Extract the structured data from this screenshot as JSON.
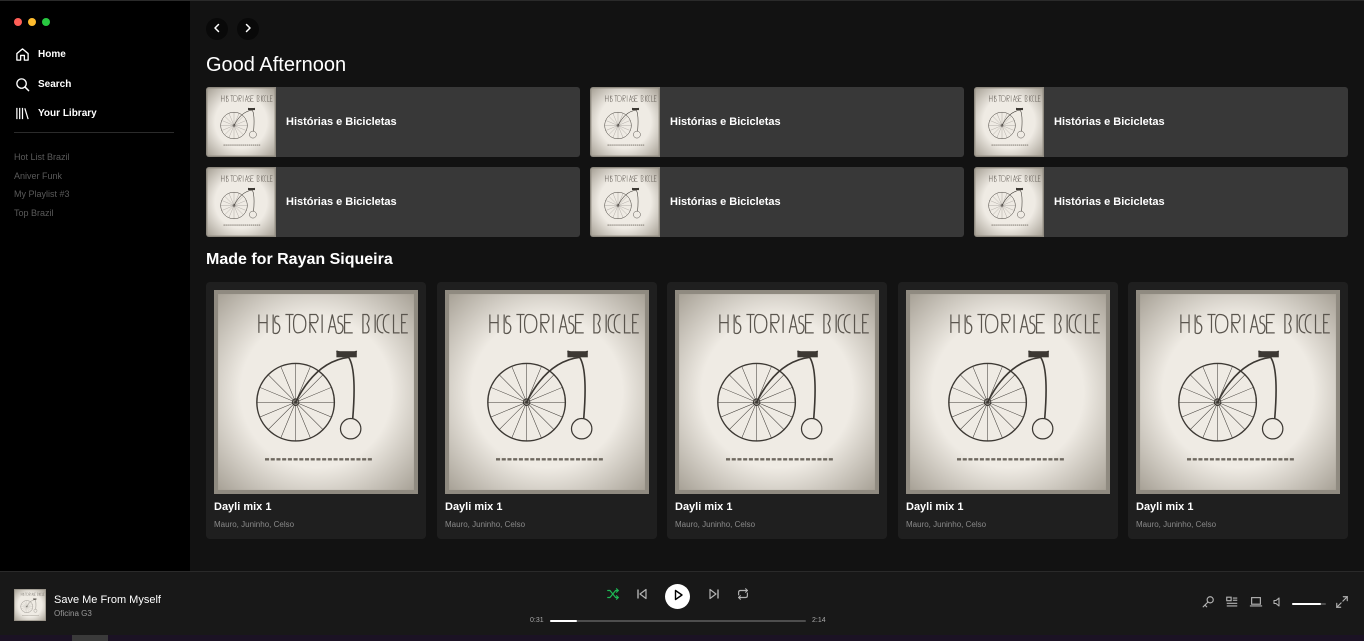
{
  "sidebar": {
    "window_controls": [
      "close",
      "minimize",
      "maximize"
    ],
    "nav": [
      {
        "label": "Home",
        "icon": "home-icon"
      },
      {
        "label": "Search",
        "icon": "search-icon"
      },
      {
        "label": "Your Library",
        "icon": "library-icon"
      }
    ],
    "playlists": [
      "Hot List Brazil",
      "Aniver Funk",
      "My Playlist #3",
      "Top Brazil"
    ]
  },
  "main": {
    "history": {
      "back_icon": "chevron-left-icon",
      "forward_icon": "chevron-right-icon"
    },
    "greeting": "Good Afternoon",
    "shortcuts": [
      {
        "title": "Histórias e Bicicletas"
      },
      {
        "title": "Histórias e Bicicletas"
      },
      {
        "title": "Histórias e Bicicletas"
      },
      {
        "title": "Histórias e Bicicletas"
      },
      {
        "title": "Histórias e Bicicletas"
      },
      {
        "title": "Histórias e Bicicletas"
      }
    ],
    "made_for_title": "Made for Rayan Siqueira",
    "cards": [
      {
        "title": "Dayli mix 1",
        "subtitle": "Mauro, Juninho, Celso"
      },
      {
        "title": "Dayli mix 1",
        "subtitle": "Mauro, Juninho, Celso"
      },
      {
        "title": "Dayli mix 1",
        "subtitle": "Mauro, Juninho, Celso"
      },
      {
        "title": "Dayli mix 1",
        "subtitle": "Mauro, Juninho, Celso"
      },
      {
        "title": "Dayli mix 1",
        "subtitle": "Mauro, Juninho, Celso"
      }
    ]
  },
  "player": {
    "track_title": "Save Me From Myself",
    "track_artist": "Oficina G3",
    "elapsed": "0:31",
    "duration": "2:14",
    "progress_fraction": 0.105,
    "shuffle_active": true,
    "volume_fraction": 0.85,
    "controls": [
      "shuffle-icon",
      "previous-icon",
      "play-icon",
      "next-icon",
      "repeat-icon"
    ],
    "right_controls": [
      "microphone-icon",
      "queue-icon",
      "device-icon",
      "volume-icon",
      "fullscreen-icon"
    ]
  },
  "colors": {
    "accent": "#1db954",
    "background": "#121212",
    "sidebar": "#000000",
    "card": "#1f1f1f",
    "shortcut": "#383838",
    "player": "#181818"
  }
}
